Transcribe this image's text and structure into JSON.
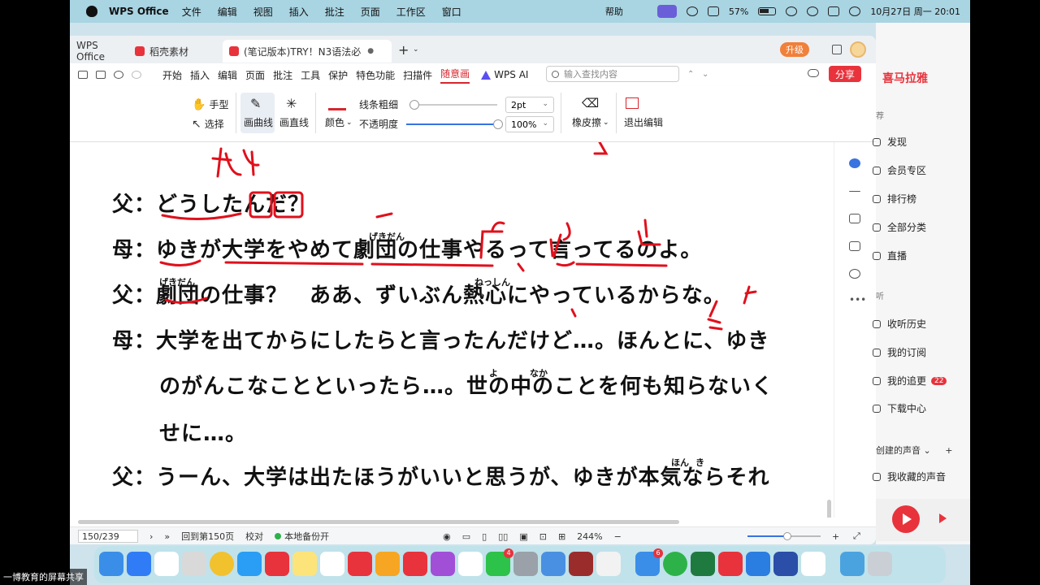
{
  "menubar": {
    "app_name": "WPS Office",
    "items": [
      "文件",
      "编辑",
      "视图",
      "插入",
      "批注",
      "页面",
      "工作区",
      "窗口"
    ],
    "help": "帮助",
    "battery": "57%",
    "datetime": "10月27日 周一  20:01"
  },
  "tabs": {
    "home": "WPS Office",
    "materials": "稻壳素材",
    "document": "(笔记版本)TRY！N3语法必",
    "upgrade": "升级"
  },
  "ribbon": {
    "menus": [
      "开始",
      "插入",
      "编辑",
      "页面",
      "批注",
      "工具",
      "保护",
      "特色功能",
      "扫描件"
    ],
    "active_menu": "随意画",
    "wps_ai": "WPS AI",
    "search_placeholder": "输入查找内容",
    "share": "分享"
  },
  "drawbar": {
    "hand": "手型",
    "select": "选择",
    "curve": "画曲线",
    "straight": "画直线",
    "color": "颜色",
    "thickness_label": "线条粗细",
    "thickness_value": "2pt",
    "thickness_level": 0.05,
    "opacity_label": "不透明度",
    "opacity_value": "100%",
    "opacity_level": 1.0,
    "eraser": "橡皮擦",
    "exit": "退出编辑"
  },
  "document": {
    "lines": [
      "父：どうしたんだ？",
      "母：ゆきが大学をやめて劇団の仕事やるって言ってるのよ。",
      "父：劇団の仕事？　ああ、ずいぶん熱心にやっているからな。",
      "母：大学を出てからにしたらと言ったんだけど…。ほんとに、ゆき",
      "のがんこなことといったら…。世の中のことを何も知らないく",
      "せに…。",
      "父：うーん、大学は出たほうがいいと思うが、ゆきが本気ならそれ"
    ],
    "ruby": {
      "gekidan1": "げきだん",
      "gekidan2": "げきだん",
      "nesshin": "ねっしん",
      "yo": "よ",
      "naka": "なか",
      "hon": "ほん",
      "ki": "き"
    }
  },
  "statusbar": {
    "page": "150/239",
    "back": "回到第150页",
    "proof": "校对",
    "backup": "本地备份开",
    "zoom": "244%"
  },
  "ximalaya": {
    "logo": "喜马拉雅",
    "recommend_tail": "荐",
    "items": [
      "发现",
      "会员专区",
      "排行榜",
      "全部分类",
      "直播"
    ],
    "section_listen": "听",
    "listen_items": [
      "收听历史",
      "我的订阅",
      "我的追更",
      "下载中心"
    ],
    "follow_badge": "22",
    "section_created": "创建的声音",
    "collected": "我收藏的声音"
  },
  "dock": {
    "badges": {
      "wechat": "4",
      "mail": "6"
    }
  },
  "screen_share_label": "一博教育的屏幕共享",
  "colors": {
    "accent_red": "#d6262e",
    "wps_upgrade": "#f0803a",
    "ink": "#e0101c",
    "active_blue": "#3873e0"
  }
}
